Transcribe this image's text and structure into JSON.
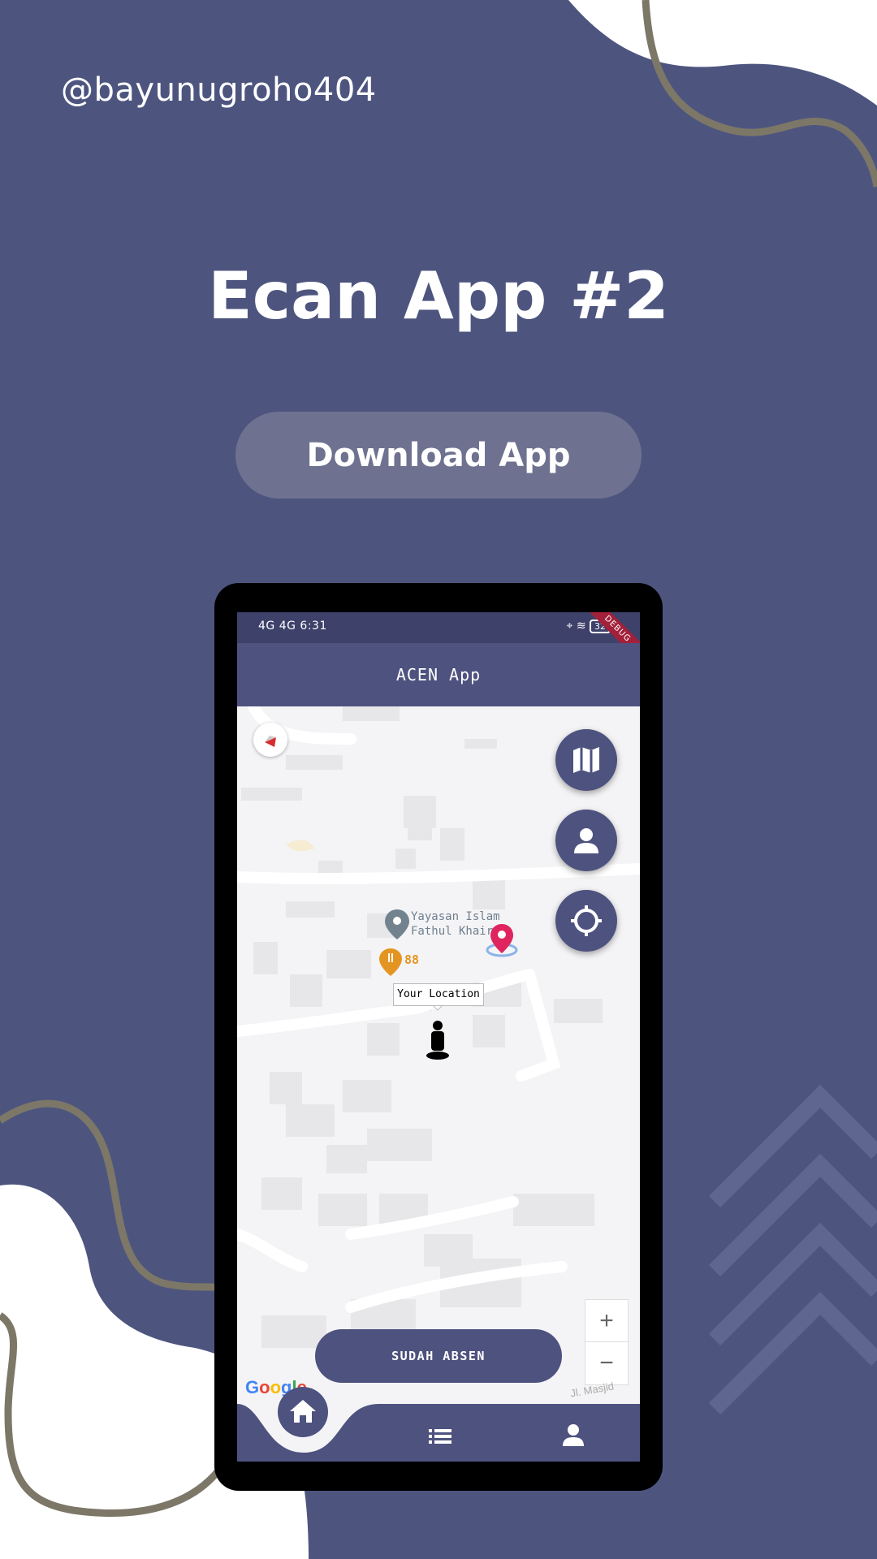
{
  "header": {
    "handle": "@bayunugroho404",
    "title": "Ecan App #2",
    "download_label": "Download App"
  },
  "colors": {
    "background": "#4d557f",
    "app_primary": "#4d527f",
    "button_muted": "#6e7290",
    "decor_line": "#7d7768",
    "marker_red": "#e0245e",
    "poi_orange": "#e49521"
  },
  "phone": {
    "status_bar": {
      "left_text": "4G 4G 6:31",
      "battery": "32",
      "debug_banner": "DEBUG"
    },
    "app_title": "ACEN App",
    "map": {
      "poi_name": [
        "Yayasan Islam",
        "Fathul Khair"
      ],
      "poi_restaurant_label": "88",
      "your_location_label": "Your Location",
      "street_label": "Jl. Masjid",
      "google_logo": "Google",
      "zoom_in": "+",
      "zoom_out": "−",
      "fab_icons": [
        "map-icon",
        "person-icon",
        "gps-target-icon"
      ]
    },
    "absen_button": "SUDAH ABSEN",
    "bottom_nav": [
      "home-icon",
      "list-icon",
      "person-icon"
    ]
  }
}
